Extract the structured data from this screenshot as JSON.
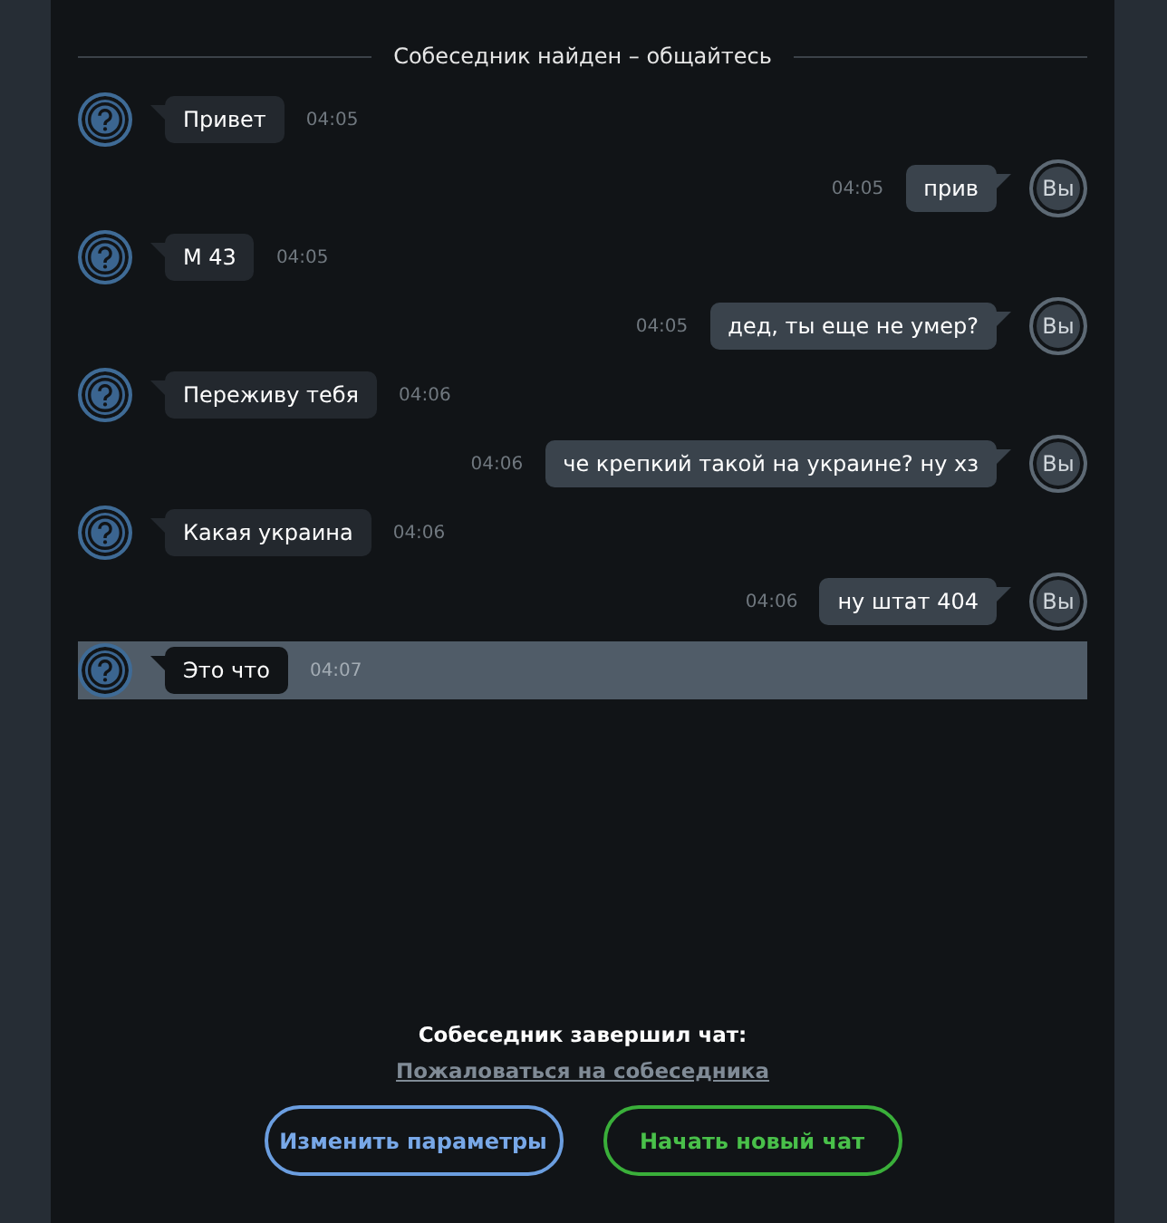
{
  "header": "Собеседник найден – общайтесь",
  "messages": [
    {
      "kind": "incoming",
      "text": "Привет",
      "time": "04:05",
      "highlighted": false
    },
    {
      "kind": "outgoing",
      "text": "прив",
      "time": "04:05",
      "avatar": "Вы",
      "highlighted": false
    },
    {
      "kind": "incoming",
      "text": "М 43",
      "time": "04:05",
      "highlighted": false
    },
    {
      "kind": "outgoing",
      "text": "дед, ты еще не умер?",
      "time": "04:05",
      "avatar": "Вы",
      "highlighted": false
    },
    {
      "kind": "incoming",
      "text": "Переживу тебя",
      "time": "04:06",
      "highlighted": false
    },
    {
      "kind": "outgoing",
      "text": "че крепкий такой на украине? ну хз",
      "time": "04:06",
      "avatar": "Вы",
      "highlighted": false
    },
    {
      "kind": "incoming",
      "text": "Какая украина",
      "time": "04:06",
      "highlighted": false
    },
    {
      "kind": "outgoing",
      "text": "ну штат 404",
      "time": "04:06",
      "avatar": "Вы",
      "highlighted": false
    },
    {
      "kind": "incoming",
      "text": "Это  что",
      "time": "04:07",
      "highlighted": true
    }
  ],
  "status": "Собеседник завершил чат:",
  "report_link": "Пожаловаться на собеседника",
  "buttons": [
    {
      "label": "Изменить параметры",
      "kind": "secondary"
    },
    {
      "label": "Начать новый чат",
      "kind": "primary"
    }
  ]
}
